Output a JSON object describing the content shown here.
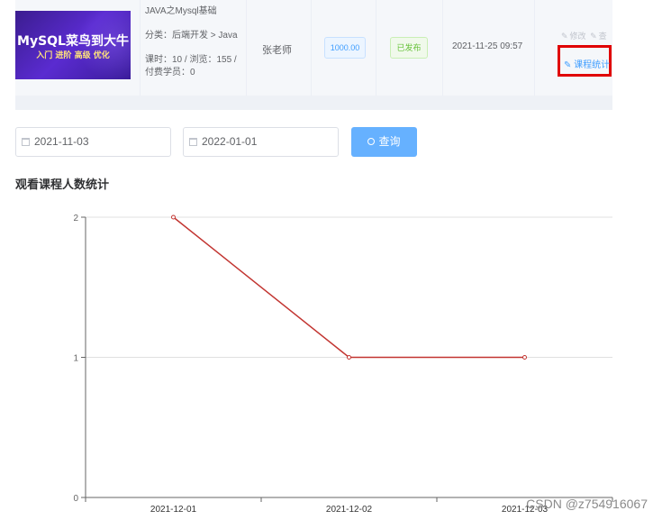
{
  "course": {
    "cover": {
      "title": "MySQL菜鸟到大牛",
      "subtitle": "入门 进阶 高级 优化"
    },
    "name": "JAVA之Mysql基础",
    "category": "分类：后端开发 > Java",
    "meta": "课时：10 / 浏览：155 / 付费学员：0",
    "teacher": "张老师",
    "price": "1000.00",
    "status": "已发布",
    "publish_time": "2021-11-25 09:57",
    "actions": {
      "edit": "修改",
      "more": "查",
      "stats": "课程统计"
    }
  },
  "filter": {
    "start_date": "2021-11-03",
    "end_date": "2022-01-01",
    "query_label": "查询"
  },
  "section_title": "观看课程人数统计",
  "chart_data": {
    "type": "line",
    "categories": [
      "2021-12-01",
      "2021-12-02",
      "2021-12-03"
    ],
    "series": [
      {
        "values": [
          2,
          1,
          1
        ],
        "color": "#c23531"
      }
    ],
    "ylim": [
      0,
      2
    ],
    "yticks": [
      "0",
      "1",
      "2"
    ],
    "grid": true
  },
  "watermark": "CSDN @z754916067"
}
